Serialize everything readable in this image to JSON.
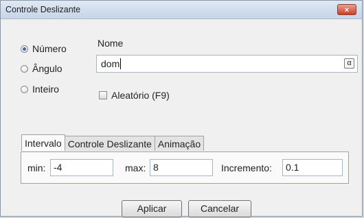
{
  "window": {
    "title": "Controle Deslizante",
    "close_label": "×"
  },
  "type_options": [
    {
      "label": "Número",
      "checked": true
    },
    {
      "label": "Ângulo",
      "checked": false
    },
    {
      "label": "Inteiro",
      "checked": false
    }
  ],
  "nome": {
    "label": "Nome",
    "value": "dom",
    "alpha_button": "α"
  },
  "random_checkbox": {
    "label": "Aleatório (F9)",
    "checked": false
  },
  "tabs": [
    {
      "label": "Intervalo",
      "active": true
    },
    {
      "label": "Controle Deslizante",
      "active": false
    },
    {
      "label": "Animação",
      "active": false
    }
  ],
  "interval": {
    "min_label": "min:",
    "min_value": "-4",
    "max_label": "max:",
    "max_value": "8",
    "increment_label": "Incremento:",
    "increment_value": "0.1"
  },
  "buttons": {
    "apply": "Aplicar",
    "cancel": "Cancelar"
  }
}
